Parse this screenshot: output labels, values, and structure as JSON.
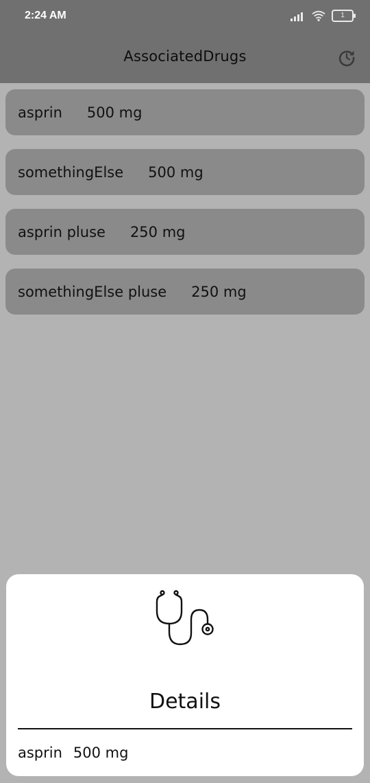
{
  "status_bar": {
    "time": "2:24 AM",
    "battery_level": "1"
  },
  "app_bar": {
    "title": "AssociatedDrugs",
    "action_icon": "refresh-icon"
  },
  "drugs": [
    {
      "name": "asprin",
      "strength": "500 mg"
    },
    {
      "name": "somethingElse",
      "strength": "500 mg"
    },
    {
      "name": "asprin pluse",
      "strength": "250 mg"
    },
    {
      "name": "somethingElse pluse",
      "strength": "250 mg"
    }
  ],
  "details_sheet": {
    "icon": "stethoscope-icon",
    "title": "Details",
    "selected_name": "asprin",
    "selected_strength": "500 mg"
  },
  "colors": {
    "app_bar": "#707070",
    "scrim_background": "#b3b3b3",
    "list_item": "#8a8a8a",
    "sheet": "#ffffff"
  }
}
